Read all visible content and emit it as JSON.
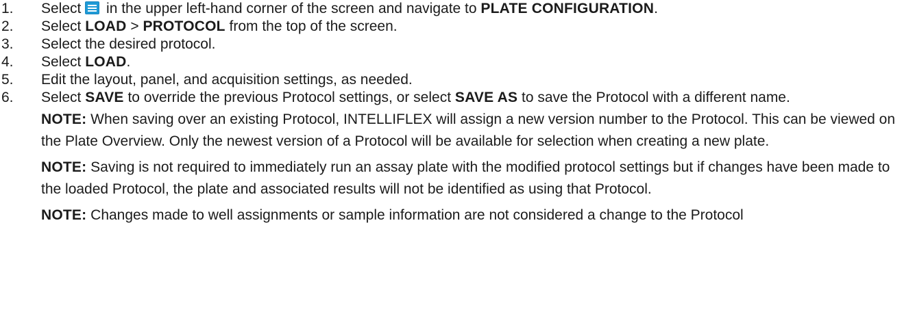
{
  "steps": [
    {
      "num": "1.",
      "pre": "Select ",
      "icon": "hamburger-menu-icon",
      "mid": " in the upper left-hand corner of the screen and navigate to ",
      "bold": "PLATE CONFIGURATION",
      "post": "."
    },
    {
      "num": "2.",
      "pre": "Select ",
      "bold1": "LOAD",
      "sep": " > ",
      "bold2": "PROTOCOL",
      "post": " from the top of the screen."
    },
    {
      "num": "3.",
      "text": "Select the desired protocol."
    },
    {
      "num": "4.",
      "pre": "Select ",
      "bold": "LOAD",
      "post": "."
    },
    {
      "num": "5.",
      "text": "Edit the layout, panel, and acquisition settings, as needed."
    },
    {
      "num": "6.",
      "pre": "Select ",
      "bold1": "SAVE",
      "mid": " to override the previous Protocol settings, or select ",
      "bold2": "SAVE AS",
      "post": " to save the Protocol with a different name.",
      "notes": [
        {
          "label": "NOTE:",
          "text": " When saving over an existing Protocol, INTELLIFLEX will assign a new version number to the Protocol. This can be viewed on the Plate Overview. Only the newest version of a Protocol will be available for selection when creating a new plate."
        },
        {
          "label": "NOTE:",
          "text": " Saving is not required to immediately run an assay plate with the modified protocol settings but if changes have been made to the loaded Protocol, the plate and associated results will not be identified as using that Protocol."
        },
        {
          "label": "NOTE:",
          "text": " Changes made to well assignments or sample information are not considered a change to the Protocol"
        }
      ]
    }
  ],
  "colors": {
    "icon_blue": "#1f9ad6",
    "text": "#1b1b1b"
  }
}
